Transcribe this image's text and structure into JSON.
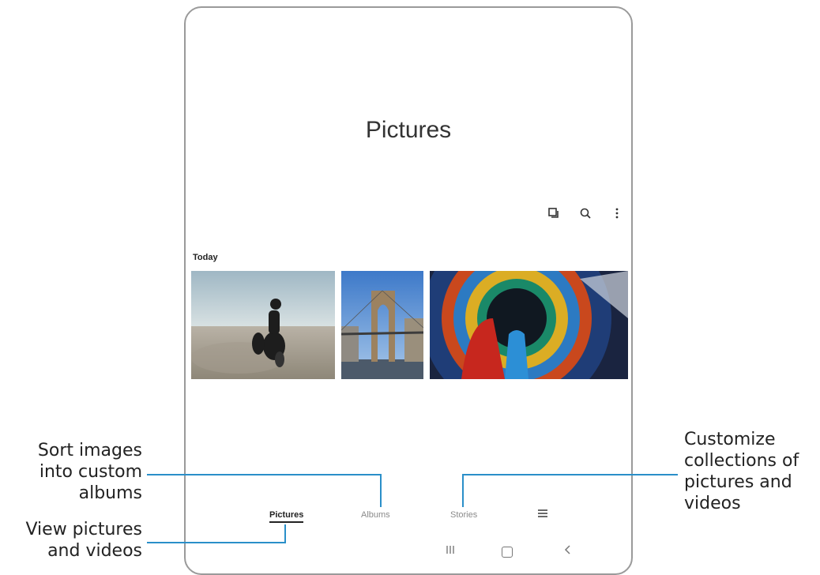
{
  "app": {
    "title": "Pictures"
  },
  "toolbar": {
    "icons": [
      "select-icon",
      "search-icon",
      "more-icon"
    ]
  },
  "section": {
    "label": "Today"
  },
  "tabs": [
    {
      "label": "Pictures",
      "active": true
    },
    {
      "label": "Albums",
      "active": false
    },
    {
      "label": "Stories",
      "active": false
    }
  ],
  "callouts": {
    "albums": [
      "Sort images",
      "into custom",
      "albums"
    ],
    "view": [
      "View pictures",
      "and videos"
    ],
    "stories": [
      "Customize",
      "collections of",
      "pictures and",
      "videos"
    ]
  },
  "colors": {
    "callout_line": "#2a8fc9",
    "frame": "#9a9a9a"
  }
}
